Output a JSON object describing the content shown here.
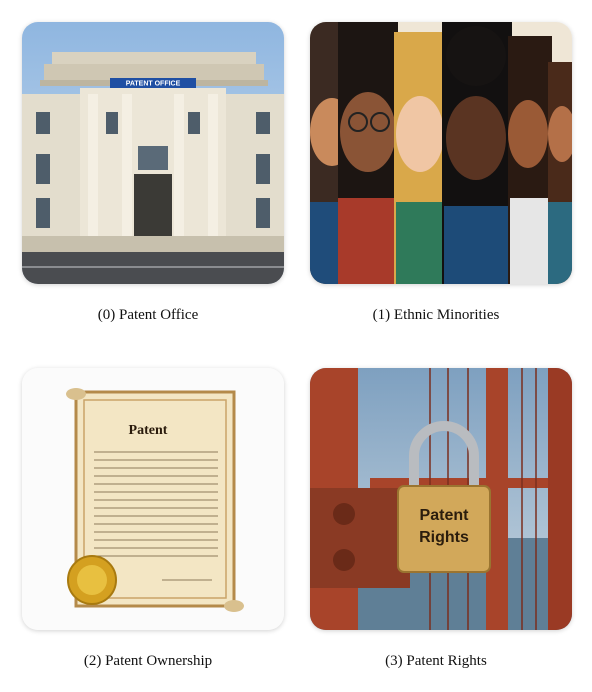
{
  "tiles": [
    {
      "index": 0,
      "caption": "(0) Patent Office",
      "image_name": "patent-office-building",
      "sign_text": "PATENT OFFICE"
    },
    {
      "index": 1,
      "caption": "(1) Ethnic Minorities",
      "image_name": "diverse-faces-illustration"
    },
    {
      "index": 2,
      "caption": "(2) Patent Ownership",
      "image_name": "patent-certificate-scroll",
      "document_title": "Patent"
    },
    {
      "index": 3,
      "caption": "(3) Patent Rights",
      "image_name": "padlock-on-bridge",
      "lock_line1": "Patent",
      "lock_line2": "Rights"
    }
  ],
  "colors": {
    "sky": "#a9c9e8",
    "stone": "#e6e0d2",
    "sign_blue": "#1f4fa3",
    "parchment": "#f3e6c4",
    "gold": "#d4a020",
    "bridge_red": "#a8442a"
  }
}
